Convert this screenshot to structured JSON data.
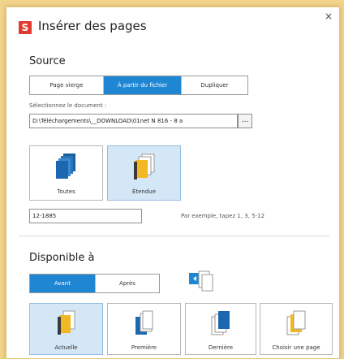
{
  "dialog": {
    "title": "Insérer des pages",
    "app_letter": "S",
    "close_glyph": "×"
  },
  "source": {
    "heading": "Source",
    "options": [
      "Page vierge",
      "À partir du fichier",
      "Dupliquer"
    ],
    "selected": "À partir du fichier",
    "select_label": "Sélectionnez le document :",
    "file_path": "D:\\Téléchargements\\__DOWNLOAD\\01net N 816 - 8 a",
    "browse_label": "...",
    "page_options": [
      {
        "label": "Toutes",
        "icon": "all-pages-icon"
      },
      {
        "label": "Étendue",
        "icon": "page-range-icon"
      }
    ],
    "page_selected": "Étendue",
    "range_value": "12-1885",
    "range_hint": "Par exemple, tapez 1, 3, 5-12"
  },
  "available": {
    "heading": "Disponible à",
    "options": [
      "Avant",
      "Après"
    ],
    "selected": "Avant",
    "position_options": [
      {
        "label": "Actuelle",
        "icon": "current-page-icon"
      },
      {
        "label": "Première",
        "icon": "first-page-icon"
      },
      {
        "label": "Dernière",
        "icon": "last-page-icon"
      },
      {
        "label": "Choisir une page",
        "icon": "choose-page-icon"
      }
    ],
    "position_selected": "Actuelle"
  },
  "colors": {
    "accent": "#1f86d4",
    "selected_bg": "#d4e7f7",
    "app_red": "#e03a2f",
    "frame": "#f3d58c"
  }
}
